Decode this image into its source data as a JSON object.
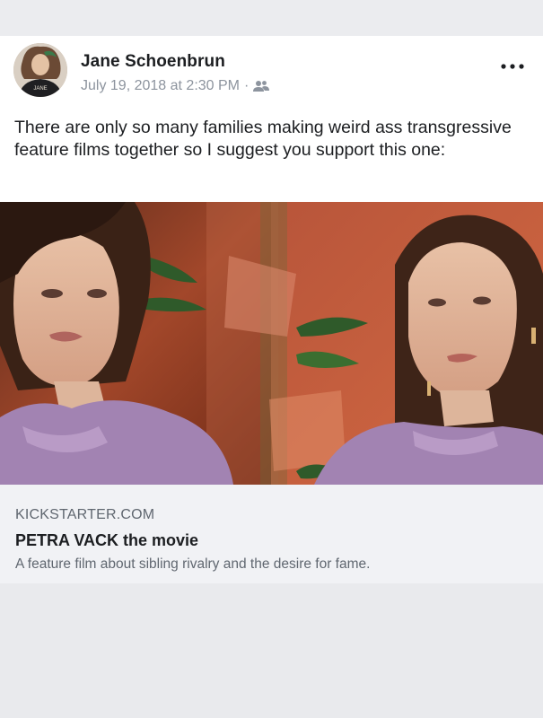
{
  "post": {
    "author": "Jane Schoenbrun",
    "timestamp": "July 19, 2018 at 2:30 PM",
    "separator": "·",
    "audience_icon": "friends-icon",
    "more_icon": "more-options-icon",
    "text": "There are only so many families making weird ass transgressive feature films together so I suggest you support this one:",
    "avatar_shirt_text": "JANE"
  },
  "link_preview": {
    "domain": "KICKSTARTER.COM",
    "title": "PETRA VACK the movie",
    "description": "A feature film about sibling rivalry and the desire for fame."
  },
  "colors": {
    "text_primary": "#1c1e21",
    "text_secondary": "#606770",
    "meta_gray": "#8d949e",
    "link_panel_bg": "#f1f2f5",
    "card_bg": "#ffffff",
    "page_bg": "#e9eaed"
  }
}
